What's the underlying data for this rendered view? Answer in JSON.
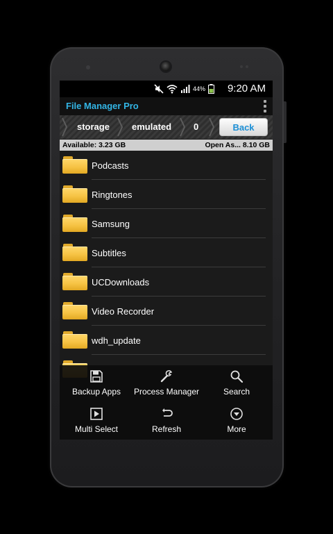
{
  "status_bar": {
    "battery_percent": "44%",
    "time": "9:20 AM"
  },
  "action_bar": {
    "title": "File Manager Pro",
    "title_color": "#33b5e5"
  },
  "breadcrumb": {
    "items": [
      "storage",
      "emulated",
      "0"
    ],
    "back_label": "Back"
  },
  "storage": {
    "available": "Available: 3.23 GB",
    "open_as": "Open As... 8.10 GB"
  },
  "files": [
    {
      "name": "Podcasts",
      "icon": "folder-icon"
    },
    {
      "name": "Ringtones",
      "icon": "folder-icon"
    },
    {
      "name": "Samsung",
      "icon": "folder-icon"
    },
    {
      "name": "Subtitles",
      "icon": "folder-icon"
    },
    {
      "name": "UCDownloads",
      "icon": "folder-icon"
    },
    {
      "name": "Video Recorder",
      "icon": "folder-icon"
    },
    {
      "name": "wdh_update",
      "icon": "folder-icon"
    }
  ],
  "menu": {
    "items": [
      {
        "label": "Backup Apps",
        "icon": "save-icon"
      },
      {
        "label": "Process Manager",
        "icon": "wrench-icon"
      },
      {
        "label": "Search",
        "icon": "search-icon"
      },
      {
        "label": "Multi Select",
        "icon": "play-box-icon"
      },
      {
        "label": "Refresh",
        "icon": "refresh-icon"
      },
      {
        "label": "More",
        "icon": "more-circle-icon"
      }
    ]
  }
}
